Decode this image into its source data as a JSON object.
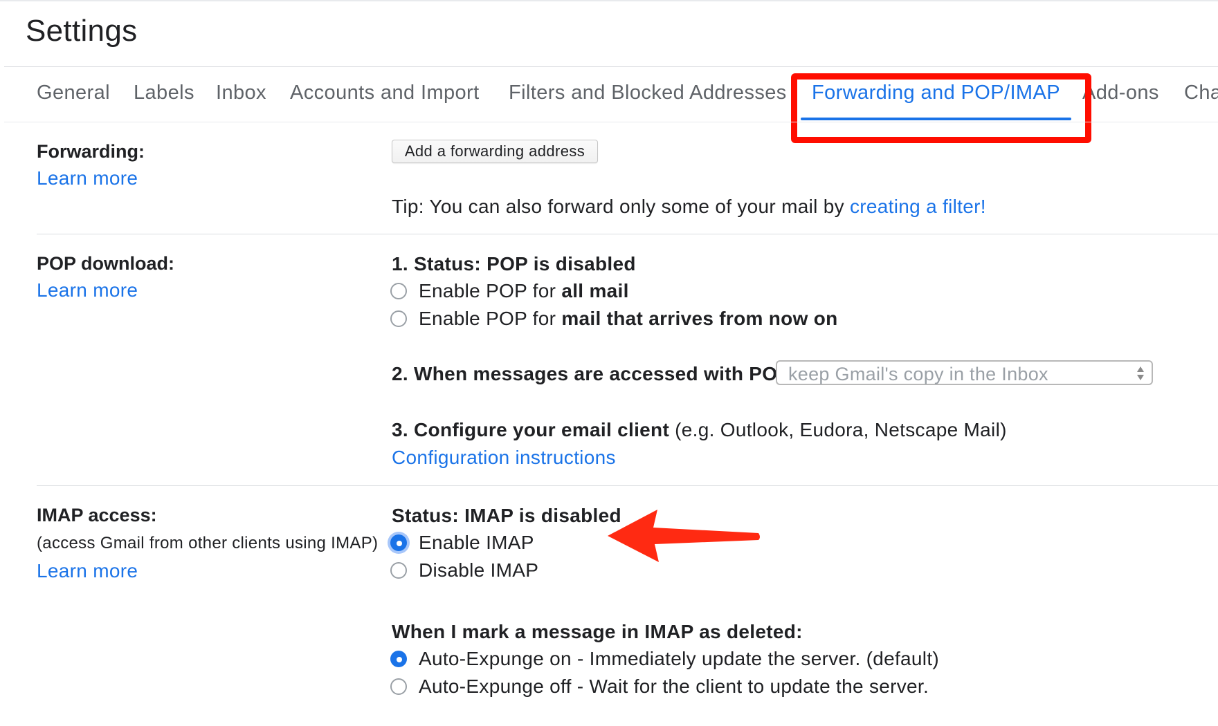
{
  "page": {
    "title": "Settings"
  },
  "tabs": [
    {
      "label": "General"
    },
    {
      "label": "Labels"
    },
    {
      "label": "Inbox"
    },
    {
      "label": "Accounts and Import"
    },
    {
      "label": "Filters and Blocked Addresses"
    },
    {
      "label": "Forwarding and POP/IMAP",
      "active": true
    },
    {
      "label": "Add-ons"
    },
    {
      "label": "Cha"
    }
  ],
  "forwarding": {
    "label": "Forwarding:",
    "learn_more": "Learn more",
    "add_button": "Add a forwarding address",
    "tip_prefix": "Tip: You can also forward only some of your mail by ",
    "tip_link": "creating a filter!"
  },
  "pop": {
    "label": "POP download:",
    "learn_more": "Learn more",
    "status": "1. Status: POP is disabled",
    "option_all_prefix": "Enable POP for ",
    "option_all_bold": "all mail",
    "option_now_prefix": "Enable POP for ",
    "option_now_bold": "mail that arrives from now on",
    "access_label": "2. When messages are accessed with POP",
    "access_select_value": "keep Gmail's copy in the Inbox",
    "configure_bold": "3. Configure your email client",
    "configure_rest": " (e.g. Outlook, Eudora, Netscape Mail)",
    "config_link": "Configuration instructions"
  },
  "imap": {
    "label": "IMAP access:",
    "sublabel": "(access Gmail from other clients using IMAP)",
    "learn_more": "Learn more",
    "status": "Status: IMAP is disabled",
    "enable": "Enable IMAP",
    "disable": "Disable IMAP",
    "deleted_heading": "When I mark a message in IMAP as deleted:",
    "expunge_on": "Auto-Expunge on - Immediately update the server. (default)",
    "expunge_off": "Auto-Expunge off - Wait for the client to update the server."
  },
  "colors": {
    "accent": "#1a73e8",
    "annotation_red": "#ff0d00",
    "text": "#202124",
    "muted": "#5f6368"
  }
}
